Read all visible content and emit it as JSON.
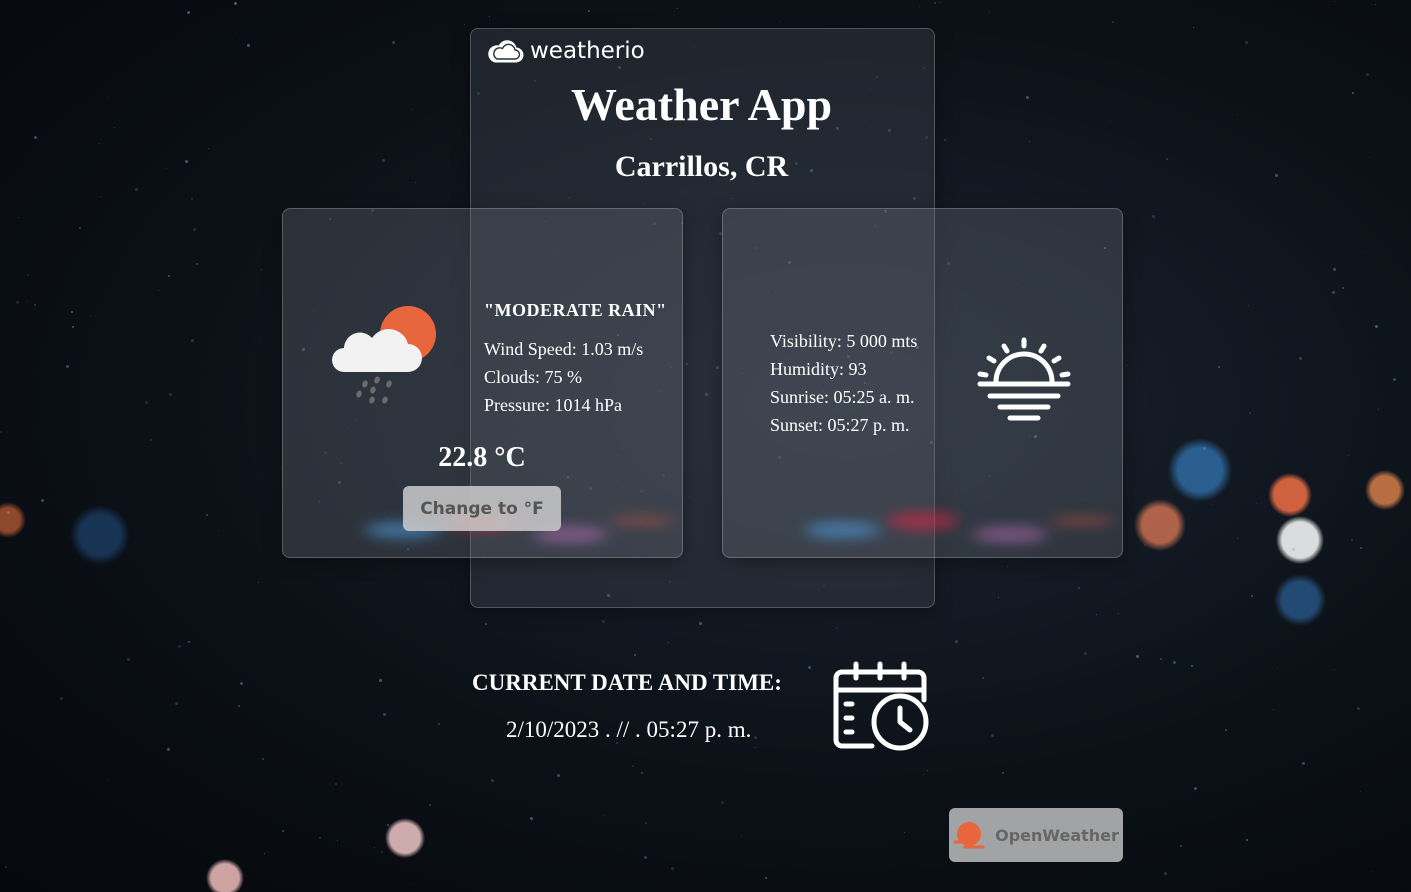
{
  "logo": {
    "text": "weatherio",
    "icon": "cloud-icon"
  },
  "header": {
    "title": "Weather App",
    "city": "Carrillos, CR"
  },
  "current": {
    "icon": "rain-cloud-sun-icon",
    "description": "\"MODERATE RAIN\"",
    "wind_speed": "Wind Speed: 1.03 m/s",
    "clouds": "Clouds: 75 %",
    "pressure": "Pressure: 1014 hPa",
    "temperature": "22.8 °C",
    "toggle_label": "Change to °F"
  },
  "details": {
    "icon": "sunrise-icon",
    "visibility": "Visibility: 5 000 mts",
    "humidity": "Humidity: 93",
    "sunrise": "Sunrise: 05:25 a. m.",
    "sunset": "Sunset: 05:27 p. m."
  },
  "datetime": {
    "label": "CURRENT DATE AND TIME:",
    "value": "2/10/2023 . // . 05:27 p. m.",
    "icon": "calendar-clock-icon"
  },
  "footer": {
    "openweather_label": "OpenWeather",
    "icon": "openweather-logo-icon"
  },
  "colors": {
    "accent_orange": "#e8663d",
    "panel": "rgba(255,255,255,0.09)"
  }
}
